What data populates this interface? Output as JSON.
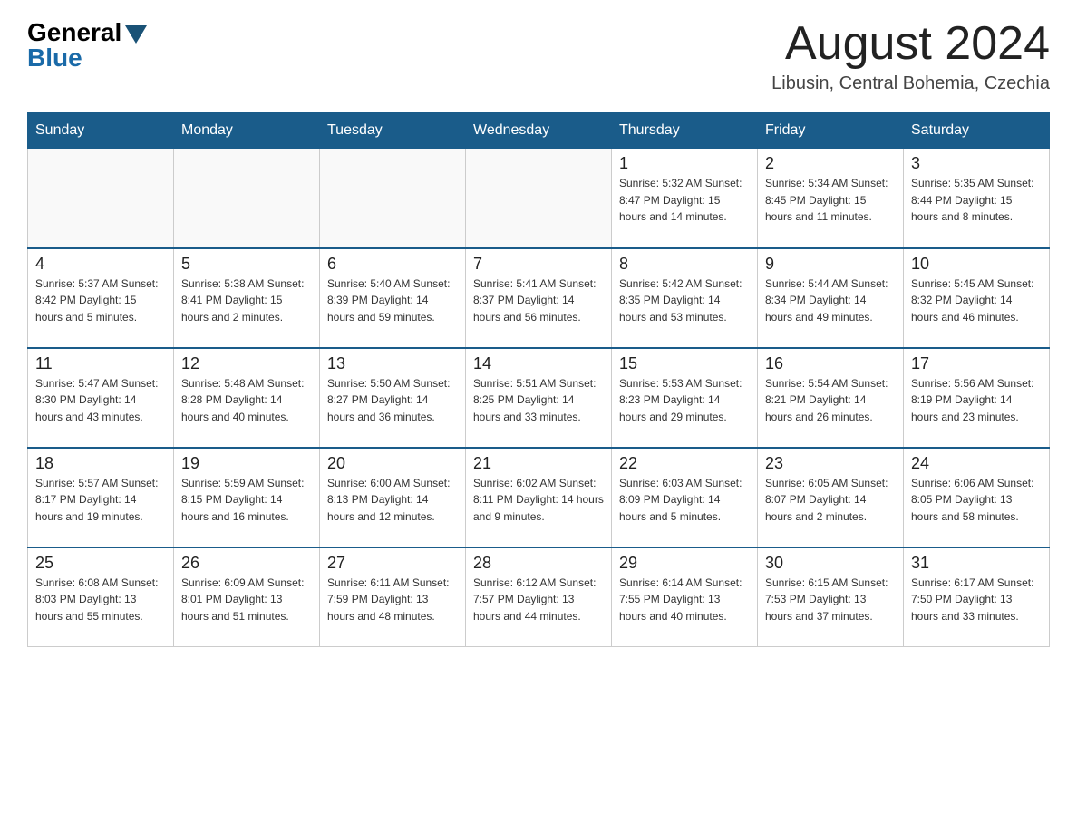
{
  "header": {
    "logo_general": "General",
    "logo_blue": "Blue",
    "month_year": "August 2024",
    "location": "Libusin, Central Bohemia, Czechia"
  },
  "weekdays": [
    "Sunday",
    "Monday",
    "Tuesday",
    "Wednesday",
    "Thursday",
    "Friday",
    "Saturday"
  ],
  "weeks": [
    [
      {
        "day": "",
        "info": ""
      },
      {
        "day": "",
        "info": ""
      },
      {
        "day": "",
        "info": ""
      },
      {
        "day": "",
        "info": ""
      },
      {
        "day": "1",
        "info": "Sunrise: 5:32 AM\nSunset: 8:47 PM\nDaylight: 15 hours\nand 14 minutes."
      },
      {
        "day": "2",
        "info": "Sunrise: 5:34 AM\nSunset: 8:45 PM\nDaylight: 15 hours\nand 11 minutes."
      },
      {
        "day": "3",
        "info": "Sunrise: 5:35 AM\nSunset: 8:44 PM\nDaylight: 15 hours\nand 8 minutes."
      }
    ],
    [
      {
        "day": "4",
        "info": "Sunrise: 5:37 AM\nSunset: 8:42 PM\nDaylight: 15 hours\nand 5 minutes."
      },
      {
        "day": "5",
        "info": "Sunrise: 5:38 AM\nSunset: 8:41 PM\nDaylight: 15 hours\nand 2 minutes."
      },
      {
        "day": "6",
        "info": "Sunrise: 5:40 AM\nSunset: 8:39 PM\nDaylight: 14 hours\nand 59 minutes."
      },
      {
        "day": "7",
        "info": "Sunrise: 5:41 AM\nSunset: 8:37 PM\nDaylight: 14 hours\nand 56 minutes."
      },
      {
        "day": "8",
        "info": "Sunrise: 5:42 AM\nSunset: 8:35 PM\nDaylight: 14 hours\nand 53 minutes."
      },
      {
        "day": "9",
        "info": "Sunrise: 5:44 AM\nSunset: 8:34 PM\nDaylight: 14 hours\nand 49 minutes."
      },
      {
        "day": "10",
        "info": "Sunrise: 5:45 AM\nSunset: 8:32 PM\nDaylight: 14 hours\nand 46 minutes."
      }
    ],
    [
      {
        "day": "11",
        "info": "Sunrise: 5:47 AM\nSunset: 8:30 PM\nDaylight: 14 hours\nand 43 minutes."
      },
      {
        "day": "12",
        "info": "Sunrise: 5:48 AM\nSunset: 8:28 PM\nDaylight: 14 hours\nand 40 minutes."
      },
      {
        "day": "13",
        "info": "Sunrise: 5:50 AM\nSunset: 8:27 PM\nDaylight: 14 hours\nand 36 minutes."
      },
      {
        "day": "14",
        "info": "Sunrise: 5:51 AM\nSunset: 8:25 PM\nDaylight: 14 hours\nand 33 minutes."
      },
      {
        "day": "15",
        "info": "Sunrise: 5:53 AM\nSunset: 8:23 PM\nDaylight: 14 hours\nand 29 minutes."
      },
      {
        "day": "16",
        "info": "Sunrise: 5:54 AM\nSunset: 8:21 PM\nDaylight: 14 hours\nand 26 minutes."
      },
      {
        "day": "17",
        "info": "Sunrise: 5:56 AM\nSunset: 8:19 PM\nDaylight: 14 hours\nand 23 minutes."
      }
    ],
    [
      {
        "day": "18",
        "info": "Sunrise: 5:57 AM\nSunset: 8:17 PM\nDaylight: 14 hours\nand 19 minutes."
      },
      {
        "day": "19",
        "info": "Sunrise: 5:59 AM\nSunset: 8:15 PM\nDaylight: 14 hours\nand 16 minutes."
      },
      {
        "day": "20",
        "info": "Sunrise: 6:00 AM\nSunset: 8:13 PM\nDaylight: 14 hours\nand 12 minutes."
      },
      {
        "day": "21",
        "info": "Sunrise: 6:02 AM\nSunset: 8:11 PM\nDaylight: 14 hours\nand 9 minutes."
      },
      {
        "day": "22",
        "info": "Sunrise: 6:03 AM\nSunset: 8:09 PM\nDaylight: 14 hours\nand 5 minutes."
      },
      {
        "day": "23",
        "info": "Sunrise: 6:05 AM\nSunset: 8:07 PM\nDaylight: 14 hours\nand 2 minutes."
      },
      {
        "day": "24",
        "info": "Sunrise: 6:06 AM\nSunset: 8:05 PM\nDaylight: 13 hours\nand 58 minutes."
      }
    ],
    [
      {
        "day": "25",
        "info": "Sunrise: 6:08 AM\nSunset: 8:03 PM\nDaylight: 13 hours\nand 55 minutes."
      },
      {
        "day": "26",
        "info": "Sunrise: 6:09 AM\nSunset: 8:01 PM\nDaylight: 13 hours\nand 51 minutes."
      },
      {
        "day": "27",
        "info": "Sunrise: 6:11 AM\nSunset: 7:59 PM\nDaylight: 13 hours\nand 48 minutes."
      },
      {
        "day": "28",
        "info": "Sunrise: 6:12 AM\nSunset: 7:57 PM\nDaylight: 13 hours\nand 44 minutes."
      },
      {
        "day": "29",
        "info": "Sunrise: 6:14 AM\nSunset: 7:55 PM\nDaylight: 13 hours\nand 40 minutes."
      },
      {
        "day": "30",
        "info": "Sunrise: 6:15 AM\nSunset: 7:53 PM\nDaylight: 13 hours\nand 37 minutes."
      },
      {
        "day": "31",
        "info": "Sunrise: 6:17 AM\nSunset: 7:50 PM\nDaylight: 13 hours\nand 33 minutes."
      }
    ]
  ]
}
